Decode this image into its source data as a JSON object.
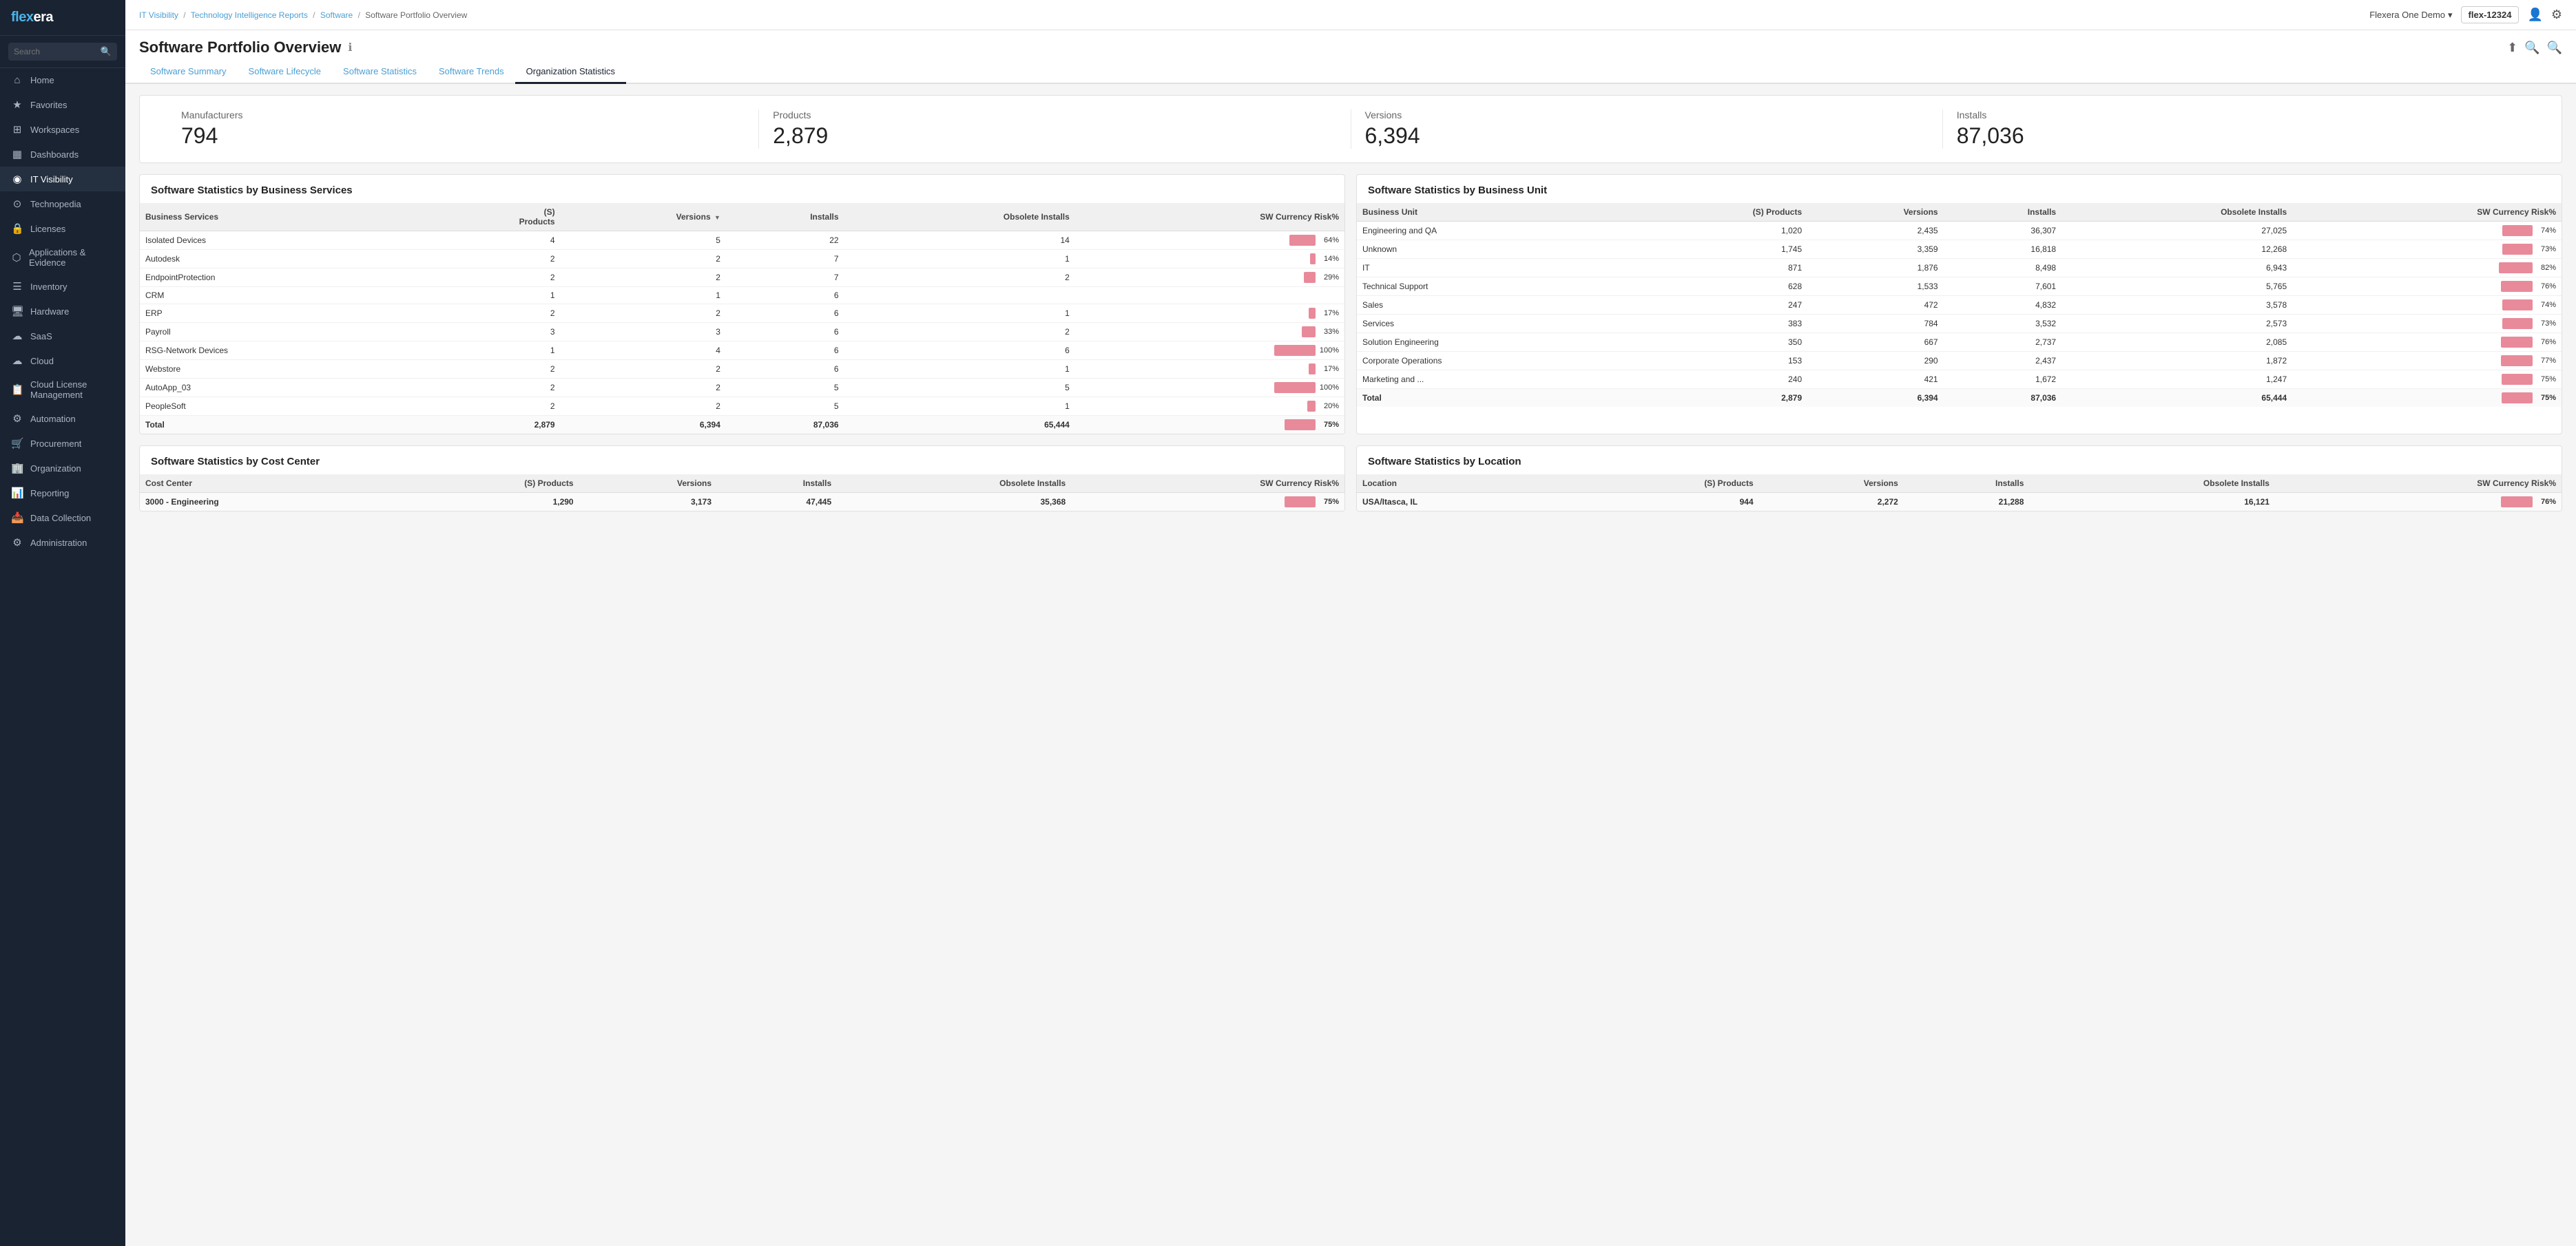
{
  "sidebar": {
    "logo": "flexera",
    "search_placeholder": "Search",
    "items": [
      {
        "id": "home",
        "label": "Home",
        "icon": "⌂"
      },
      {
        "id": "favorites",
        "label": "Favorites",
        "icon": "★"
      },
      {
        "id": "workspaces",
        "label": "Workspaces",
        "icon": "⊞"
      },
      {
        "id": "dashboards",
        "label": "Dashboards",
        "icon": "▦"
      },
      {
        "id": "it-visibility",
        "label": "IT Visibility",
        "icon": "◉",
        "active": true
      },
      {
        "id": "technopedia",
        "label": "Technopedia",
        "icon": "⊙"
      },
      {
        "id": "licenses",
        "label": "Licenses",
        "icon": "🔒"
      },
      {
        "id": "applications",
        "label": "Applications & Evidence",
        "icon": "⬡"
      },
      {
        "id": "inventory",
        "label": "Inventory",
        "icon": "☰"
      },
      {
        "id": "hardware",
        "label": "Hardware",
        "icon": "🖥"
      },
      {
        "id": "saas",
        "label": "SaaS",
        "icon": "☁"
      },
      {
        "id": "cloud",
        "label": "Cloud",
        "icon": "☁"
      },
      {
        "id": "cloud-license",
        "label": "Cloud License Management",
        "icon": "📋"
      },
      {
        "id": "automation",
        "label": "Automation",
        "icon": "⚙"
      },
      {
        "id": "procurement",
        "label": "Procurement",
        "icon": "🛒"
      },
      {
        "id": "organization",
        "label": "Organization",
        "icon": "🏢"
      },
      {
        "id": "reporting",
        "label": "Reporting",
        "icon": "📊"
      },
      {
        "id": "data-collection",
        "label": "Data Collection",
        "icon": "📥"
      },
      {
        "id": "administration",
        "label": "Administration",
        "icon": "⚙"
      }
    ]
  },
  "topbar": {
    "breadcrumb": [
      "IT Visibility",
      "Technology Intelligence Reports",
      "Software",
      "Software Portfolio Overview"
    ],
    "demo_label": "Flexera One Demo",
    "flex_id": "flex-12324"
  },
  "page": {
    "title": "Software Portfolio Overview",
    "tabs": [
      {
        "id": "summary",
        "label": "Software Summary",
        "active": false
      },
      {
        "id": "lifecycle",
        "label": "Software Lifecycle",
        "active": false
      },
      {
        "id": "statistics",
        "label": "Software Statistics",
        "active": false
      },
      {
        "id": "trends",
        "label": "Software Trends",
        "active": false
      },
      {
        "id": "org-stats",
        "label": "Organization Statistics",
        "active": true
      }
    ]
  },
  "stats": {
    "manufacturers": {
      "label": "Manufacturers",
      "value": "794"
    },
    "products": {
      "label": "Products",
      "value": "2,879"
    },
    "versions": {
      "label": "Versions",
      "value": "6,394"
    },
    "installs": {
      "label": "Installs",
      "value": "87,036"
    }
  },
  "business_services": {
    "title": "Software Statistics by Business Services",
    "columns": [
      "Business Services",
      "(S) Products",
      "Versions",
      "Installs",
      "Obsolete Installs",
      "SW Currency Risk%"
    ],
    "rows": [
      {
        "name": "Isolated Devices",
        "products": 4,
        "versions": 5,
        "installs": 22,
        "obsolete": 14,
        "risk": 64
      },
      {
        "name": "Autodesk",
        "products": 2,
        "versions": 2,
        "installs": 7,
        "obsolete": 1,
        "risk": 14
      },
      {
        "name": "EndpointProtection",
        "products": 2,
        "versions": 2,
        "installs": 7,
        "obsolete": 2,
        "risk": 29
      },
      {
        "name": "CRM",
        "products": 1,
        "versions": 1,
        "installs": 6,
        "obsolete": "",
        "risk": null
      },
      {
        "name": "ERP",
        "products": 2,
        "versions": 2,
        "installs": 6,
        "obsolete": 1,
        "risk": 17
      },
      {
        "name": "Payroll",
        "products": 3,
        "versions": 3,
        "installs": 6,
        "obsolete": 2,
        "risk": 33
      },
      {
        "name": "RSG-Network Devices",
        "products": 1,
        "versions": 4,
        "installs": 6,
        "obsolete": 6,
        "risk": 100
      },
      {
        "name": "Webstore",
        "products": 2,
        "versions": 2,
        "installs": 6,
        "obsolete": 1,
        "risk": 17
      },
      {
        "name": "AutoApp_03",
        "products": 2,
        "versions": 2,
        "installs": 5,
        "obsolete": 5,
        "risk": 100
      },
      {
        "name": "PeopleSoft",
        "products": 2,
        "versions": 2,
        "installs": 5,
        "obsolete": 1,
        "risk": 20
      }
    ],
    "total": {
      "name": "Total",
      "products": "2,879",
      "versions": "6,394",
      "installs": "87,036",
      "obsolete": "65,444",
      "risk": 75
    }
  },
  "business_unit": {
    "title": "Software Statistics by Business Unit",
    "columns": [
      "Business Unit",
      "(S) Products",
      "Versions",
      "Installs",
      "Obsolete Installs",
      "SW Currency Risk%"
    ],
    "rows": [
      {
        "name": "Engineering and QA",
        "products": "1,020",
        "versions": "2,435",
        "installs": "36,307",
        "obsolete": "27,025",
        "risk": 74
      },
      {
        "name": "Unknown",
        "products": "1,745",
        "versions": "3,359",
        "installs": "16,818",
        "obsolete": "12,268",
        "risk": 73
      },
      {
        "name": "IT",
        "products": 871,
        "versions": "1,876",
        "installs": "8,498",
        "obsolete": "6,943",
        "risk": 82
      },
      {
        "name": "Technical Support",
        "products": 628,
        "versions": "1,533",
        "installs": "7,601",
        "obsolete": "5,765",
        "risk": 76
      },
      {
        "name": "Sales",
        "products": 247,
        "versions": 472,
        "installs": "4,832",
        "obsolete": "3,578",
        "risk": 74
      },
      {
        "name": "Services",
        "products": 383,
        "versions": 784,
        "installs": "3,532",
        "obsolete": "2,573",
        "risk": 73
      },
      {
        "name": "Solution Engineering",
        "products": 350,
        "versions": 667,
        "installs": "2,737",
        "obsolete": "2,085",
        "risk": 76
      },
      {
        "name": "Corporate Operations",
        "products": 153,
        "versions": 290,
        "installs": "2,437",
        "obsolete": "1,872",
        "risk": 77
      },
      {
        "name": "Marketing and ...",
        "products": 240,
        "versions": 421,
        "installs": "1,672",
        "obsolete": "1,247",
        "risk": 75
      }
    ],
    "total": {
      "name": "Total",
      "products": "2,879",
      "versions": "6,394",
      "installs": "87,036",
      "obsolete": "65,444",
      "risk": 75
    }
  },
  "cost_center": {
    "title": "Software Statistics by Cost Center",
    "columns": [
      "Cost Center",
      "(S) Products",
      "Versions",
      "Installs",
      "Obsolete Installs",
      "SW Currency Risk%"
    ],
    "rows": [
      {
        "name": "3000 - Engineering",
        "products": "1,290",
        "versions": "3,173",
        "installs": "47,445",
        "obsolete": "35,368",
        "risk": 75
      }
    ],
    "total": null
  },
  "location": {
    "title": "Software Statistics by Location",
    "columns": [
      "Location",
      "(S) Products",
      "Versions",
      "Installs",
      "Obsolete Installs",
      "SW Currency Risk%"
    ],
    "rows": [
      {
        "name": "USA/Itasca, IL",
        "products": 944,
        "versions": "2,272",
        "installs": "21,288",
        "obsolete": "16,121",
        "risk": 76
      }
    ],
    "total": null
  },
  "colors": {
    "accent": "#4a9fd4",
    "brand": "#1a2332",
    "risk_bar": "#e88a9a",
    "active_tab_underline": "#1a2332"
  }
}
